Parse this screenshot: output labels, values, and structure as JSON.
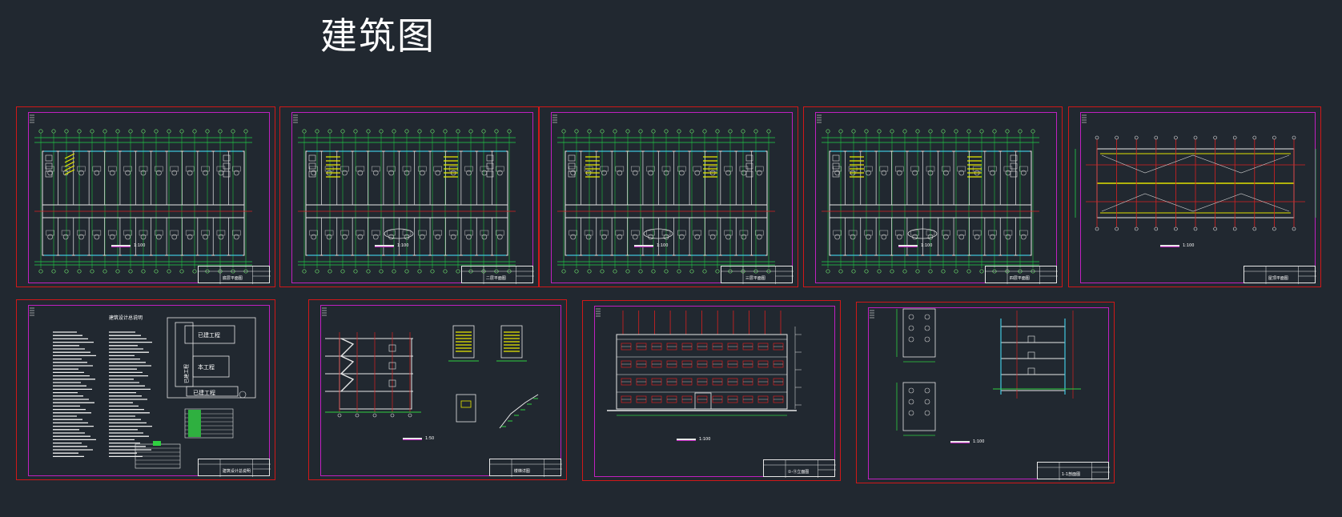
{
  "title": "建筑图",
  "sheets": [
    {
      "name": "floor-plan-1",
      "label": "底层平面图",
      "scale": "1:100",
      "kind": "plan"
    },
    {
      "name": "floor-plan-2",
      "label": "二层平面图",
      "scale": "1:100",
      "kind": "plan"
    },
    {
      "name": "floor-plan-3",
      "label": "三层平面图",
      "scale": "1:100",
      "kind": "plan"
    },
    {
      "name": "floor-plan-4",
      "label": "四层平面图",
      "scale": "1:100",
      "kind": "plan"
    },
    {
      "name": "roof-plan",
      "label": "屋顶平面图",
      "scale": "1:100",
      "kind": "roof"
    },
    {
      "name": "design-notes",
      "label": "建筑设计总说明",
      "scale": "",
      "kind": "notes"
    },
    {
      "name": "stair-details",
      "label": "楼梯详图",
      "scale": "1:50",
      "kind": "stair"
    },
    {
      "name": "front-elevation",
      "label": "①-⑪立面图",
      "scale": "1:100",
      "kind": "elevation"
    },
    {
      "name": "section-details",
      "label": "1-1剖面图",
      "scale": "1:100",
      "kind": "section"
    }
  ],
  "site_plan": {
    "existing_top": "已建工程",
    "existing_side": "已建工程",
    "new_building": "本工程",
    "existing_bottom": "已建工程"
  },
  "notes_heading": "建筑设计总说明"
}
